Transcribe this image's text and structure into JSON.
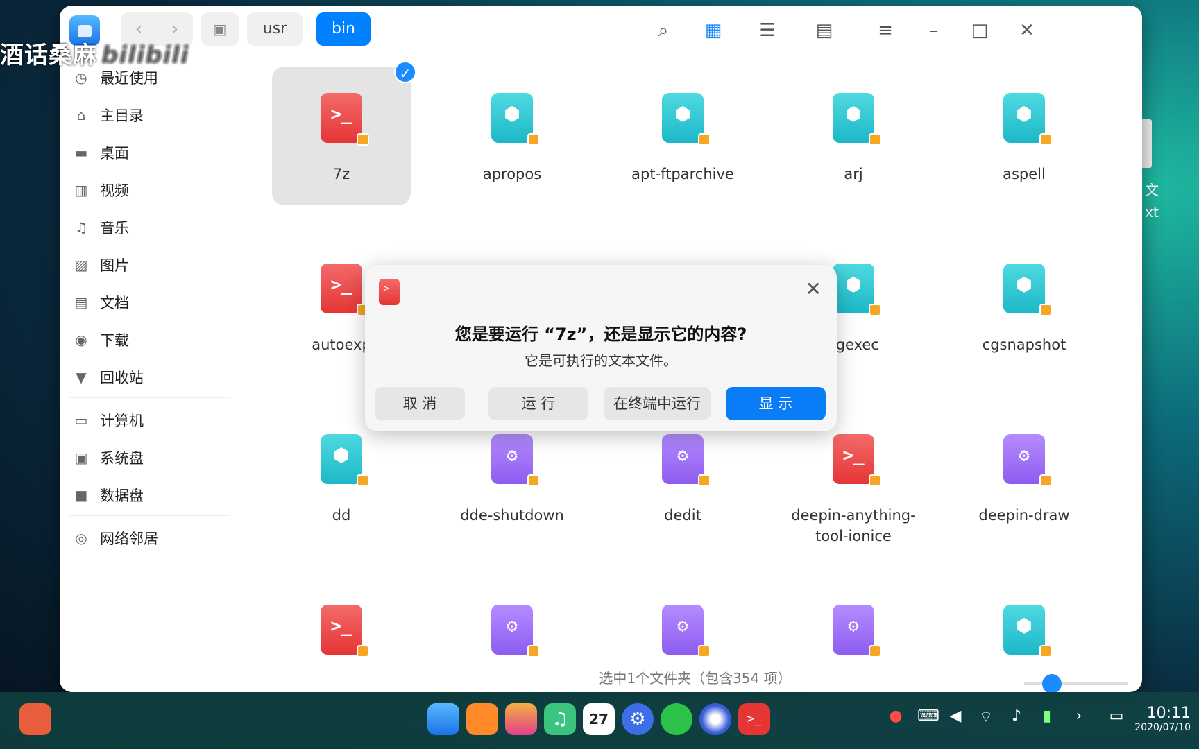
{
  "watermark": {
    "text": "酒话桑麻",
    "logo": "bilibili"
  },
  "desktop": {
    "file_label_1": "文",
    "file_label_2": "xt"
  },
  "toolbar": {
    "back": "‹",
    "forward": "›",
    "breadcrumbs": [
      "usr",
      "bin"
    ],
    "icons": [
      "search-icon",
      "icon-view-icon",
      "list-view-icon",
      "detail-view-icon",
      "menu-icon",
      "minimize-icon",
      "maximize-icon",
      "close-icon"
    ]
  },
  "sidebar": {
    "items": [
      {
        "label": "最近使用",
        "icon": "clock-icon"
      },
      {
        "label": "主目录",
        "icon": "home-icon"
      },
      {
        "label": "桌面",
        "icon": "desktop-icon"
      },
      {
        "label": "视频",
        "icon": "video-icon"
      },
      {
        "label": "音乐",
        "icon": "music-icon"
      },
      {
        "label": "图片",
        "icon": "picture-icon"
      },
      {
        "label": "文档",
        "icon": "document-icon"
      },
      {
        "label": "下载",
        "icon": "download-icon"
      },
      {
        "label": "回收站",
        "icon": "trash-icon"
      },
      {
        "label": "计算机",
        "icon": "computer-icon"
      },
      {
        "label": "系统盘",
        "icon": "system-disk-icon"
      },
      {
        "label": "数据盘",
        "icon": "data-disk-icon"
      },
      {
        "label": "网络邻居",
        "icon": "network-icon"
      }
    ]
  },
  "files": [
    {
      "name": "7z",
      "type": "script"
    },
    {
      "name": "apropos",
      "type": "binary"
    },
    {
      "name": "apt-ftparchive",
      "type": "binary"
    },
    {
      "name": "arj",
      "type": "binary"
    },
    {
      "name": "aspell",
      "type": "binary"
    },
    {
      "name": "autoexp",
      "type": "script"
    },
    {
      "name": "cgexec",
      "type": "binary"
    },
    {
      "name": "cgsnapshot",
      "type": "binary"
    },
    {
      "name": "dd",
      "type": "binary"
    },
    {
      "name": "dde-shutdown",
      "type": "app"
    },
    {
      "name": "dedit",
      "type": "app"
    },
    {
      "name": "deepin-anything-tool-ionice",
      "type": "script"
    },
    {
      "name": "deepin-draw",
      "type": "app"
    },
    {
      "name": "",
      "type": "script"
    },
    {
      "name": "",
      "type": "app"
    },
    {
      "name": "",
      "type": "app"
    },
    {
      "name": "",
      "type": "app"
    },
    {
      "name": "",
      "type": "binary"
    }
  ],
  "status": {
    "text": "选中1个文件夹（包含354 项）"
  },
  "dialog": {
    "title": "您是要运行 “7z”，还是显示它的内容?",
    "message": "它是可执行的文本文件。",
    "buttons": {
      "cancel": "取 消",
      "run": "运 行",
      "run_terminal": "在终端中运行",
      "show": "显 示"
    }
  },
  "taskbar": {
    "time": "10:11",
    "date": "2020/07/10",
    "calendar_day": "27"
  },
  "colors": {
    "accent": "#0081ff",
    "script": "#e53535",
    "binary": "#1cb8c8",
    "app": "#8d5cf0"
  }
}
